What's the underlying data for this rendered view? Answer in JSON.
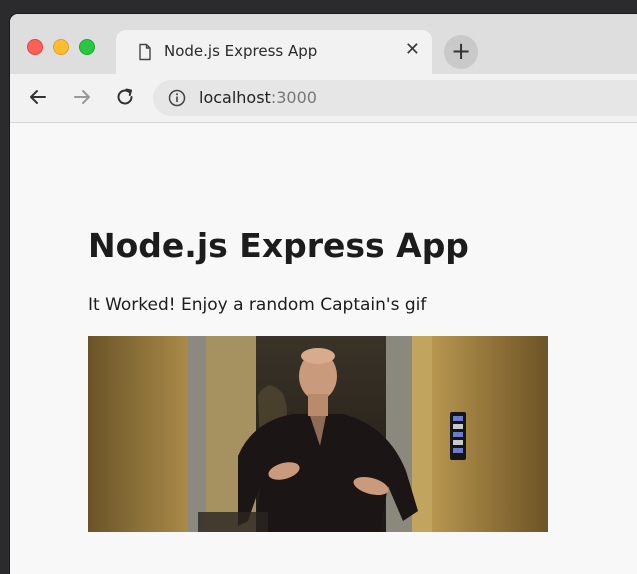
{
  "browser": {
    "tab": {
      "title": "Node.js Express App",
      "icon": "document-icon",
      "close_glyph": "✕"
    },
    "new_tab_glyph": "+",
    "address": {
      "host": "localhost",
      "port": ":3000"
    }
  },
  "page": {
    "heading": "Node.js Express App",
    "message": "It Worked! Enjoy a random Captain's gif",
    "image": {
      "description": "animated-gif",
      "subject": "man-in-dark-outfit-gesturing"
    }
  },
  "colors": {
    "traffic_red": "#fe5f57",
    "traffic_yellow": "#febc2e",
    "traffic_green": "#28c840",
    "tab_background": "#f2f2f2",
    "page_background": "#f8f8f8"
  }
}
